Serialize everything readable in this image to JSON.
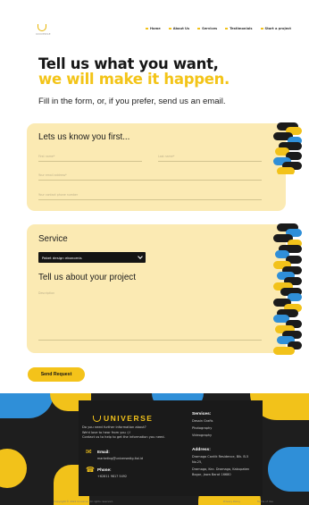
{
  "nav": {
    "logo_text": "UNIVERSE",
    "links": [
      "Home",
      "About Us",
      "Services",
      "Testimonials",
      "Start a project"
    ]
  },
  "hero": {
    "title_line1": "Tell us what you want,",
    "title_line2": "we will make it happen.",
    "subtitle": "Fill in the form, or, if you prefer, send us an email."
  },
  "form_personal": {
    "heading": "Lets us know you first...",
    "first_name_placeholder": "First name*",
    "last_name_placeholder": "Last name*",
    "email_placeholder": "Your email address*",
    "phone_placeholder": "Your contact phone number"
  },
  "form_service": {
    "service_heading": "Service",
    "service_selected": "Paket design ekonomis",
    "project_heading": "Tell us about your project",
    "project_placeholder": "Description"
  },
  "send_button": "Send Request",
  "footer": {
    "logo_text": "UNIVERSE",
    "tagline_1": "Do you need further information about?",
    "tagline_2": "We'd love to hear from you :)!",
    "tagline_3": "Contact us to help to get the information you need.",
    "email_label": "Email:",
    "email_value": "marketing@universedig.ital.id",
    "phone_label": "Phone:",
    "phone_value": "+62811 9817 5492",
    "services_title": "Services:",
    "services": [
      "Desain Grafis",
      "Photography",
      "Videography"
    ],
    "address_title": "Address:",
    "address_lines": [
      "Dramaga Cantik Residence, Blk. B-5",
      "No.25,",
      "Dramaga, Kec. Dramaga, Kabupaten",
      "Bogor, Jawa Barat 16680"
    ],
    "copyright": "Copyright © 2022 Universe. All rights reserved.",
    "bottom_links": [
      "Privacy Policy",
      "Terms of Use"
    ]
  },
  "colors": {
    "accent_yellow": "#f2c21a",
    "card_cream": "#fbeab3",
    "pattern_blue": "#2f8fd8",
    "footer_dark": "#1e1e1e"
  }
}
